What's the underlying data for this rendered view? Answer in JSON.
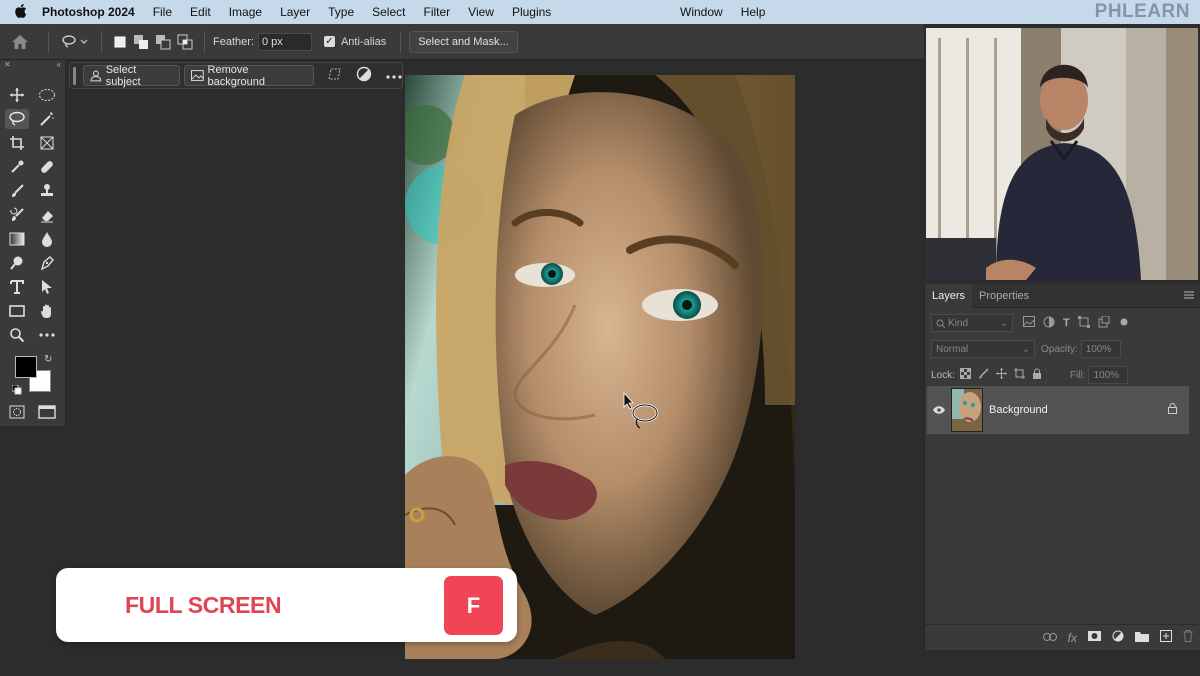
{
  "menubar": {
    "app_name": "Photoshop 2024",
    "items": [
      "File",
      "Edit",
      "Image",
      "Layer",
      "Type",
      "Select",
      "Filter",
      "View",
      "Plugins"
    ],
    "right_items": [
      "Window",
      "Help"
    ],
    "watermark": "PHLEARN"
  },
  "options_bar": {
    "feather_label": "Feather:",
    "feather_value": "0 px",
    "antialias_label": "Anti-alias",
    "antialias_checked": true,
    "select_and_mask_label": "Select and Mask..."
  },
  "toolbar": {
    "active_tool": "lasso-tool",
    "foreground_color": "#000000",
    "background_color": "#ffffff"
  },
  "context_taskbar": {
    "select_subject_label": "Select subject",
    "remove_background_label": "Remove background"
  },
  "layers_panel": {
    "tabs": [
      "Layers",
      "Properties"
    ],
    "active_tab": "Layers",
    "filter_placeholder": "Kind",
    "blend_mode": "Normal",
    "opacity_label": "Opacity:",
    "opacity_value": "100%",
    "lock_label": "Lock:",
    "fill_label": "Fill:",
    "fill_value": "100%",
    "layers": [
      {
        "name": "Background",
        "visible": true,
        "locked": true
      }
    ]
  },
  "banner": {
    "title": "FULL SCREEN",
    "shortcut_key": "F"
  },
  "colors": {
    "menubar_bg": "#c5d9ea",
    "panel_bg": "#3a3a3a",
    "workspace_bg": "#2c2c2c",
    "banner_accent": "#ef4554"
  }
}
